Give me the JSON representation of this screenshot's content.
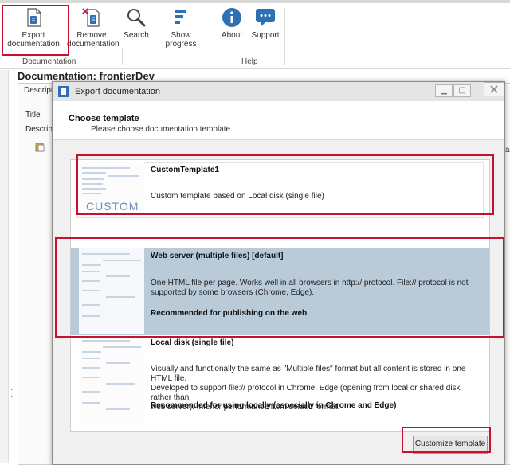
{
  "ribbon": {
    "buttons": [
      {
        "id": "export",
        "label": "Export documentation",
        "line1": "Export",
        "line2": "documentation"
      },
      {
        "id": "remove",
        "label": "Remove documentation",
        "line1": "Remove",
        "line2": "documentation"
      },
      {
        "id": "search",
        "label": "Search"
      },
      {
        "id": "progress",
        "label": "Show progress"
      },
      {
        "id": "about",
        "label": "About"
      },
      {
        "id": "support",
        "label": "Support"
      }
    ],
    "groups": {
      "documentation": "Documentation",
      "help": "Help"
    }
  },
  "background": {
    "doc_title": "Documentation: frontierDev",
    "tab_partial": "Descripti",
    "title_label": "Title",
    "desc_label": "Descripti",
    "right_fragment": "ar"
  },
  "dialog": {
    "title": "Export documentation",
    "heading": "Choose template",
    "subheading": "Please choose documentation template.",
    "templates": [
      {
        "name": "CustomTemplate1",
        "description": "Custom template based on Local disk (single file)",
        "thumb_label": "CUSTOM"
      },
      {
        "name": "Web server (multiple files) [default]",
        "description_line1": "One HTML file per page. Works well in all browsers in http:// protocol. File:// protocol is not",
        "description_line2": "supported by some browsers (Chrome, Edge).",
        "recommendation": "Recommended for publishing on the web",
        "selected": true
      },
      {
        "name": "Local disk (single file)",
        "description_line1": "Visually and functionally the same as \"Multiple files\" format but all content is stored in one HTML file.",
        "description_line2": "Developed to support file:// protocol in Chrome, Edge (opening from local or shared disk rather than",
        "description_line3": "web server). Inferior performance from default format.",
        "recommendation": "Recommended for using locally (especially in Chrome and Edge)"
      }
    ],
    "customize_label": "Customize template"
  },
  "colors": {
    "accent_blue": "#2f6fb3",
    "selected_row": "#b9cad9",
    "annotation_red": "#c8102e"
  }
}
